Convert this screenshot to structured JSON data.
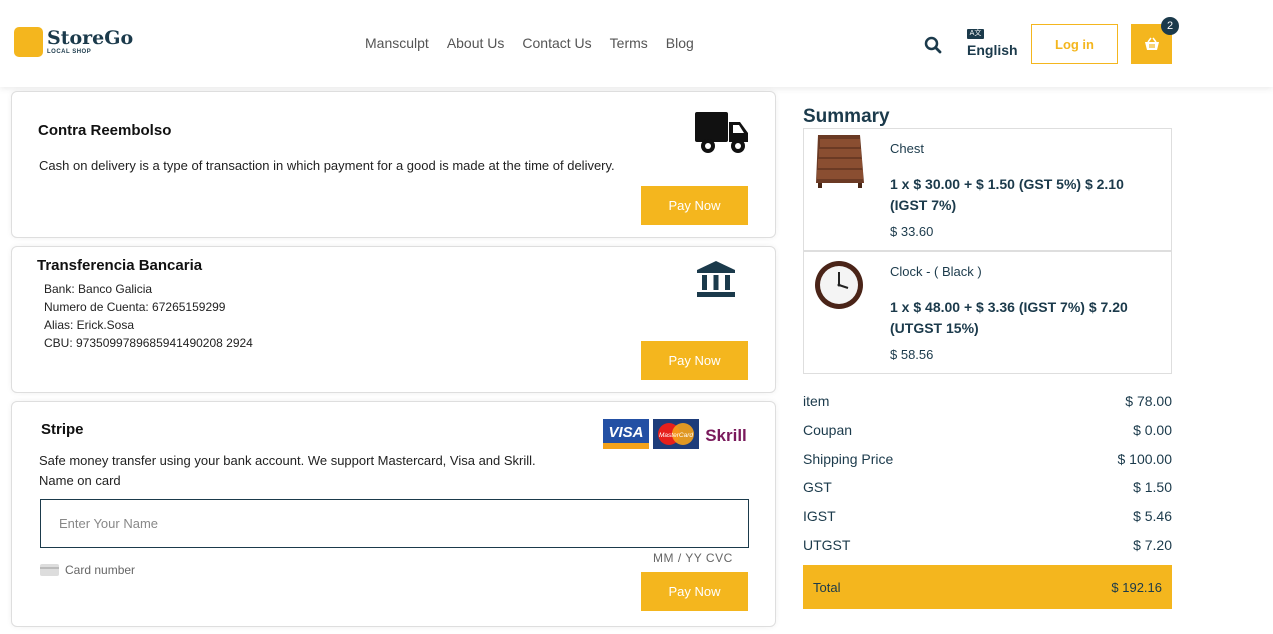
{
  "header": {
    "logo_name": "StoreGo",
    "logo_sub": "LOCAL SHOP",
    "nav": [
      "Mansculpt",
      "About Us",
      "Contact Us",
      "Terms",
      "Blog"
    ],
    "lang_glyph": "A文",
    "language": "English",
    "login_label": "Log in",
    "cart_count": "2",
    "brand_color": "#f4b61e",
    "dark_color": "#1b3a4b"
  },
  "payments": {
    "cod": {
      "title": "Contra Reembolso",
      "description": "Cash on delivery is a type of transaction in which payment for a good is made at the time of delivery.",
      "button": "Pay Now",
      "icon": "truck-icon"
    },
    "bank": {
      "title": "Transferencia Bancaria",
      "lines": [
        "Bank: Banco Galicia",
        "Numero de Cuenta: 67265159299",
        "Alias: Erick.Sosa",
        "CBU: 9735099789685941490208 2924"
      ],
      "button": "Pay Now",
      "icon": "bank-icon"
    },
    "stripe": {
      "title": "Stripe",
      "description": "Safe money transfer using your bank account. We support Mastercard, Visa and Skrill.",
      "name_label": "Name on card",
      "name_placeholder": "Enter Your Name",
      "card_number_label": "Card number",
      "mm_yy_cvc": "MM / YY  CVC",
      "button": "Pay Now",
      "visa_label": "VISA",
      "mastercard_label": "MasterCard",
      "skrill_label": "Skrill"
    }
  },
  "summary": {
    "title": "Summary",
    "items": [
      {
        "name": "Chest",
        "calc": "1 x $ 30.00 + $ 1.50 (GST 5%) $ 2.10 (IGST 7%)",
        "total": "$ 33.60",
        "icon": "chest-icon"
      },
      {
        "name": "Clock - ( Black )",
        "calc": "1 x $ 48.00 + $ 3.36 (IGST 7%) $ 7.20 (UTGST 15%)",
        "total": "$ 58.56",
        "icon": "clock-icon"
      }
    ],
    "rows": [
      {
        "label": "item",
        "value": "$ 78.00"
      },
      {
        "label": "Coupan",
        "value": "$ 0.00"
      },
      {
        "label": "Shipping Price",
        "value": "$ 100.00"
      },
      {
        "label": "GST",
        "value": "$ 1.50"
      },
      {
        "label": "IGST",
        "value": "$ 5.46"
      },
      {
        "label": "UTGST",
        "value": "$ 7.20"
      }
    ],
    "total_label": "Total",
    "total_value": "$ 192.16"
  }
}
